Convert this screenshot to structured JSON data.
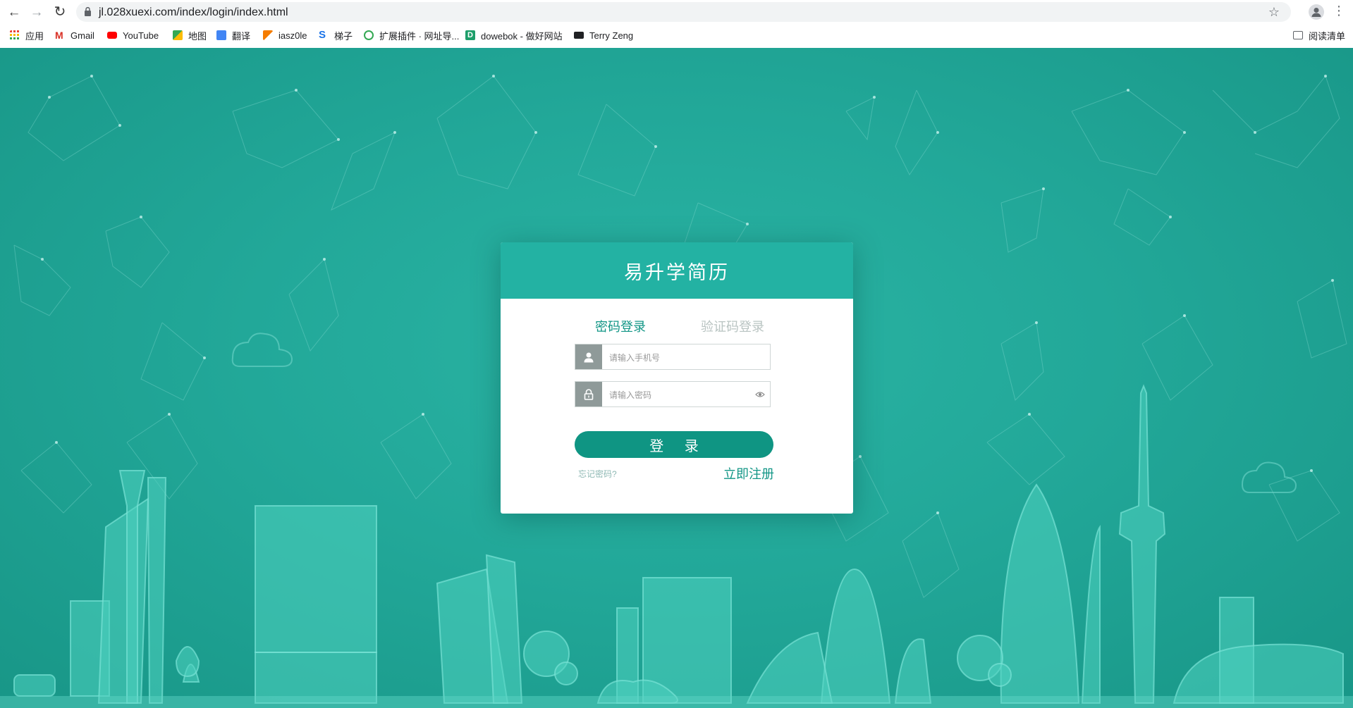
{
  "browser": {
    "url": "jl.028xuexi.com/index/login/index.html",
    "bookmarks": [
      {
        "label": "应用",
        "icon": "apps-grid-icon",
        "color": "#ea4335"
      },
      {
        "label": "Gmail",
        "icon": "gmail-icon",
        "color": "#d93025"
      },
      {
        "label": "YouTube",
        "icon": "youtube-icon",
        "color": "#ff0000"
      },
      {
        "label": "地图",
        "icon": "maps-icon",
        "color": "#34a853"
      },
      {
        "label": "翻译",
        "icon": "translate-icon",
        "color": "#4285f4"
      },
      {
        "label": "iasz0le",
        "icon": "flag-icon",
        "color": "#f57c00"
      },
      {
        "label": "梯子",
        "icon": "s-logo-icon",
        "color": "#1a73e8"
      },
      {
        "label": "扩展插件 · 网址导...",
        "icon": "puzzle-icon",
        "color": "#34a853"
      },
      {
        "label": "dowebok - 做好网站",
        "icon": "d-logo-icon",
        "color": "#1e9e6a"
      },
      {
        "label": "Terry Zeng",
        "icon": "terminal-icon",
        "color": "#202124"
      }
    ],
    "reading_list": "阅读清单"
  },
  "login": {
    "title": "易升学简历",
    "tabs": [
      "密码登录",
      "验证码登录"
    ],
    "phone_placeholder": "请输入手机号",
    "password_placeholder": "请输入密码",
    "login_button": "登 录",
    "forgot_link": "忘记密码?",
    "register_link": "立即注册"
  },
  "colors": {
    "accent": "#23b2a3",
    "button": "#0f9583",
    "page_bg": "#1fa596"
  }
}
